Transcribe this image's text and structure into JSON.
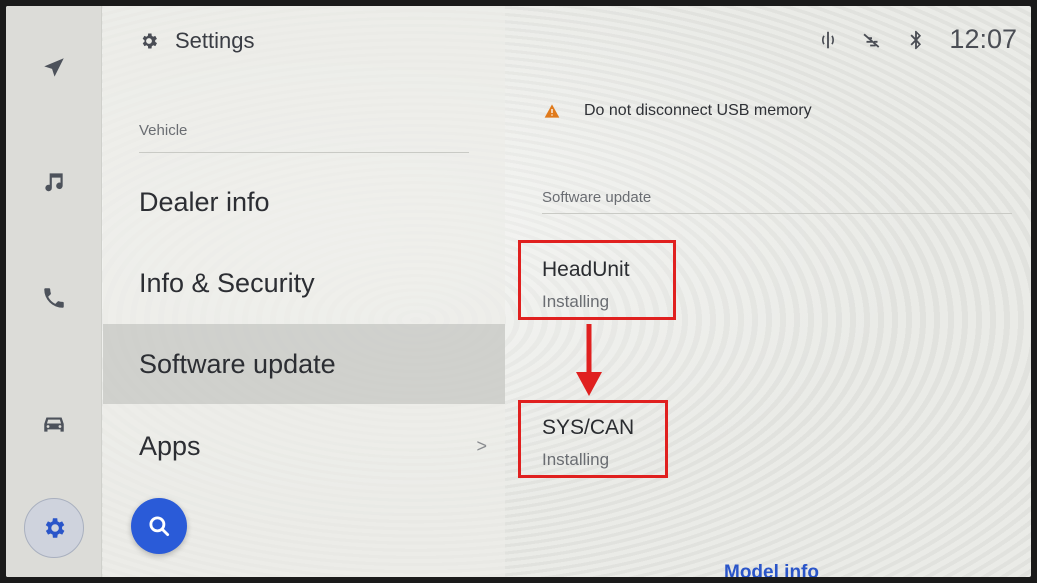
{
  "header": {
    "title": "Settings"
  },
  "status_bar": {
    "time": "12:07"
  },
  "rail": {
    "items": [
      {
        "name": "navigation",
        "icon": "navigation-arrow-icon"
      },
      {
        "name": "media",
        "icon": "music-note-icon"
      },
      {
        "name": "phone",
        "icon": "phone-icon"
      },
      {
        "name": "vehicle",
        "icon": "car-icon"
      },
      {
        "name": "settings",
        "icon": "gear-icon",
        "active": true
      }
    ]
  },
  "menu": {
    "section": "Vehicle",
    "items": [
      {
        "label": "Dealer info"
      },
      {
        "label": "Info & Security"
      },
      {
        "label": "Software update",
        "selected": true
      },
      {
        "label": "Apps",
        "chevron": ">"
      }
    ]
  },
  "pane": {
    "warning": "Do not disconnect USB memory",
    "section": "Software update",
    "updates": [
      {
        "name": "HeadUnit",
        "status": "Installing"
      },
      {
        "name": "SYS/CAN",
        "status": "Installing"
      }
    ],
    "footer_link": "Model info"
  },
  "colors": {
    "accent": "#2a5bd8",
    "highlight": "#e0201f",
    "warning": "#e07a1b"
  }
}
